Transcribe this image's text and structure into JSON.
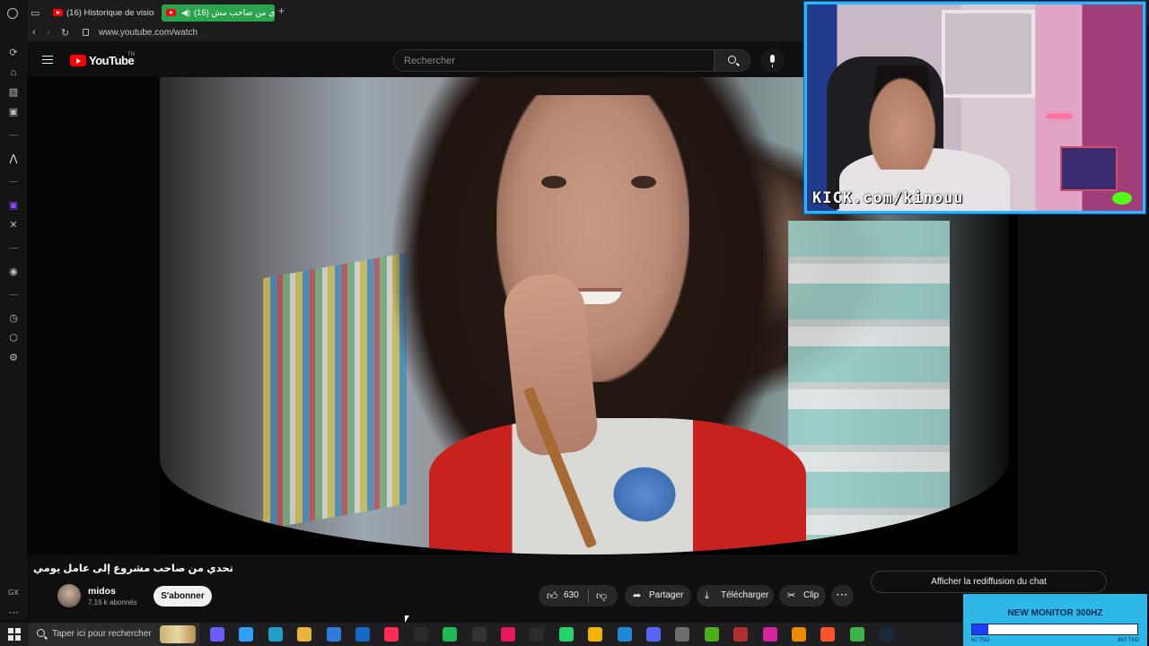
{
  "browser": {
    "tabs": [
      {
        "label": "(16) Historique de visionna"
      },
      {
        "label": "(16) تحدي من صاحب مش"
      }
    ],
    "new_tab_glyph": "+",
    "url": "www.youtube.com/watch",
    "sidebar_label": "GX",
    "sidebar_icons": [
      "home-icon",
      "briefcase-icon",
      "gamepad-icon",
      "messenger-icon",
      "drop-icon",
      "twitch-icon",
      "x-icon",
      "player-icon",
      "history-icon",
      "extensions-icon",
      "settings-icon"
    ]
  },
  "youtube": {
    "logo_text": "YouTube",
    "logo_region": "TN",
    "search_placeholder": "Rechercher",
    "video": {
      "title": "تحدي من صاحب مشروع إلى عامل يومي",
      "channel": "midos",
      "subscribers": "7,16 k abonnés",
      "subscribe_label": "S'abonner",
      "likes": "630",
      "share_label": "Partager",
      "download_label": "Télécharger",
      "clip_label": "Clip",
      "more_label": "···"
    },
    "chat_replay_label": "Afficher la rediffusion du chat"
  },
  "stream_overlay": {
    "kick_handle": "KICK.com/kinouu",
    "monitor_goal": {
      "title": "NEW MONITOR 300HZ",
      "progress": 0.1,
      "min_label": "50 TND",
      "max_label": "850 TND"
    }
  },
  "taskbar": {
    "search_placeholder": "Taper ici pour rechercher",
    "apps": [
      {
        "name": "copilot-icon",
        "color": "#6b5cff"
      },
      {
        "name": "paint-icon",
        "color": "#2ea0ff"
      },
      {
        "name": "edge-icon",
        "color": "#1fa0c8"
      },
      {
        "name": "file-explorer-icon",
        "color": "#e8b53a"
      },
      {
        "name": "store-icon",
        "color": "#2f7cdc"
      },
      {
        "name": "outlook-icon",
        "color": "#1369c7"
      },
      {
        "name": "opera-gx-icon",
        "color": "#ff2d55"
      },
      {
        "name": "obs-icon",
        "color": "#2b2b2b"
      },
      {
        "name": "spotify-icon",
        "color": "#1db954"
      },
      {
        "name": "capcut-icon",
        "color": "#333333"
      },
      {
        "name": "tiktok-icon",
        "color": "#e6185b"
      },
      {
        "name": "capcut-editor-icon",
        "color": "#2a2a2a"
      },
      {
        "name": "whatsapp-icon",
        "color": "#25d366"
      },
      {
        "name": "chrome-icon",
        "color": "#f2b400"
      },
      {
        "name": "vscode-icon",
        "color": "#1e8ad6"
      },
      {
        "name": "discord-icon",
        "color": "#5865f2"
      },
      {
        "name": "settings-icon",
        "color": "#6d6d6d"
      },
      {
        "name": "nvidia-icon",
        "color": "#4caf1a"
      },
      {
        "name": "game-icon",
        "color": "#b03030"
      },
      {
        "name": "instagram-icon",
        "color": "#d6249f"
      },
      {
        "name": "vlc-icon",
        "color": "#f08a00"
      },
      {
        "name": "brave-icon",
        "color": "#fb542b"
      },
      {
        "name": "notepad-icon",
        "color": "#3bb44a"
      },
      {
        "name": "steam-icon",
        "color": "#1b2838"
      }
    ]
  }
}
